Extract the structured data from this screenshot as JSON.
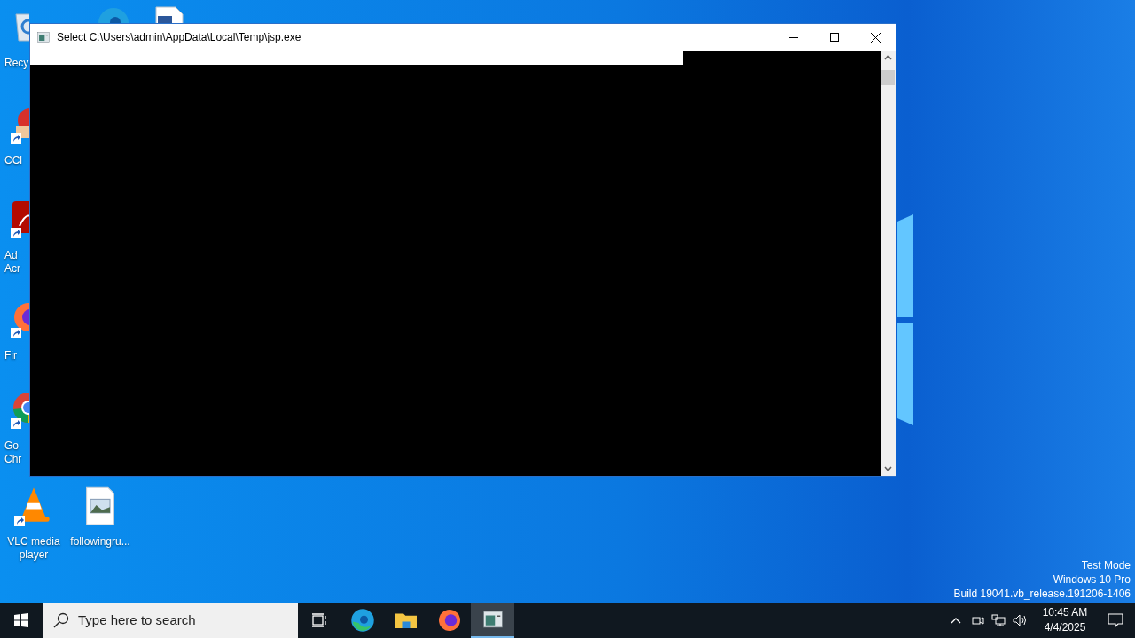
{
  "desktop": {
    "top_icons": [
      {
        "kind": "edge"
      },
      {
        "kind": "document"
      }
    ],
    "icons": [
      {
        "kind": "recycle-bin",
        "shortcut": false,
        "lines": [
          "Recy"
        ]
      },
      {
        "kind": "ccleaner",
        "shortcut": true,
        "lines": [
          "CCl"
        ]
      },
      {
        "kind": "acrobat",
        "shortcut": true,
        "lines": [
          "Ad",
          "Acr"
        ]
      },
      {
        "kind": "firefox",
        "shortcut": true,
        "lines": [
          "Fir"
        ]
      },
      {
        "kind": "chrome",
        "shortcut": true,
        "lines": [
          "Go",
          "Chr"
        ]
      }
    ],
    "bottom_icons": [
      {
        "kind": "vlc",
        "shortcut": true,
        "lines": [
          "VLC media",
          "player"
        ]
      },
      {
        "kind": "image-file",
        "shortcut": false,
        "lines": [
          "followingru..."
        ]
      }
    ],
    "watermark": [
      "Test Mode",
      "Windows 10 Pro",
      "Build 19041.vb_release.191206-1406"
    ]
  },
  "window": {
    "title": "Select C:\\Users\\admin\\AppData\\Local\\Temp\\jsp.exe",
    "selection": true
  },
  "taskbar": {
    "search": {
      "placeholder": "Type here to search"
    },
    "apps": [
      {
        "kind": "edge",
        "selected": false
      },
      {
        "kind": "explorer",
        "selected": false
      },
      {
        "kind": "firefox",
        "selected": false
      },
      {
        "kind": "console",
        "selected": true
      }
    ],
    "time": "10:45 AM",
    "date": "4/4/2025"
  }
}
